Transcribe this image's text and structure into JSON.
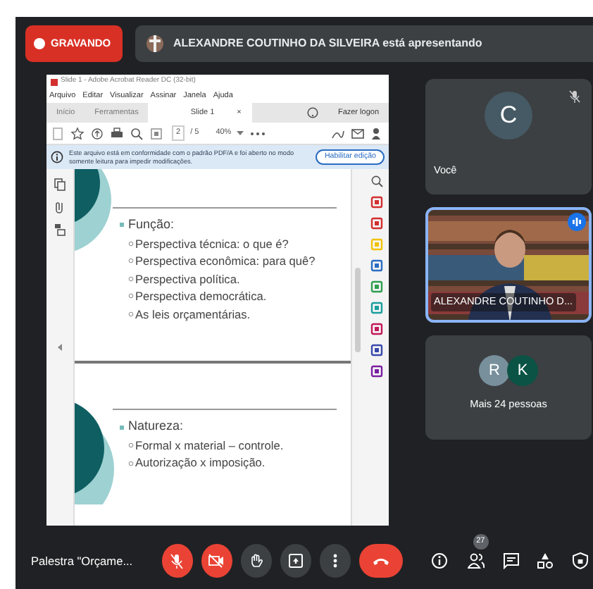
{
  "recording": {
    "label": "GRAVANDO"
  },
  "presenter": {
    "text": "ALEXANDRE COUTINHO DA SILVEIRA está apresentando"
  },
  "pdf": {
    "title": "Slide 1 - Adobe Acrobat Reader DC (32-bit)",
    "menu": [
      "Arquivo",
      "Editar",
      "Visualizar",
      "Assinar",
      "Janela",
      "Ajuda"
    ],
    "tabs": [
      {
        "label": "Início",
        "selected": false
      },
      {
        "label": "Ferramentas",
        "selected": false
      },
      {
        "label": "Slide 1",
        "selected": true,
        "close": "×"
      }
    ],
    "login": "Fazer logon",
    "page": "2",
    "page_total": "/ 5",
    "zoom": "40%",
    "info": "Este arquivo está em conformidade com o padrão PDF/A e foi aberto no modo somente leitura para impedir modificações.",
    "enable_button": "Habilitar edição",
    "slides": [
      {
        "heading": "Função:",
        "bullets": [
          "Perspectiva técnica: o que é?",
          "Perspectiva econômica: para quê?",
          "Perspectiva política.",
          "Perspectiva democrática.",
          "As leis orçamentárias."
        ]
      },
      {
        "heading": "Natureza:",
        "bullets": [
          "Formal x material – controle.",
          "Autorização x imposição."
        ]
      }
    ]
  },
  "tiles": [
    {
      "kind": "avatar",
      "initial": "C",
      "label": "Você",
      "muted": true
    },
    {
      "kind": "video",
      "label": "ALEXANDRE COUTINHO D...",
      "speaking": true
    },
    {
      "kind": "group",
      "initials": [
        {
          "letter": "R",
          "color": "#78909c"
        },
        {
          "letter": "K",
          "color": "#0b5345"
        }
      ],
      "label": "Mais 24 pessoas"
    }
  ],
  "meeting": {
    "title": "Palestra \"Orçame...",
    "mic_off": true,
    "camera_off": true,
    "people_count": "27"
  }
}
